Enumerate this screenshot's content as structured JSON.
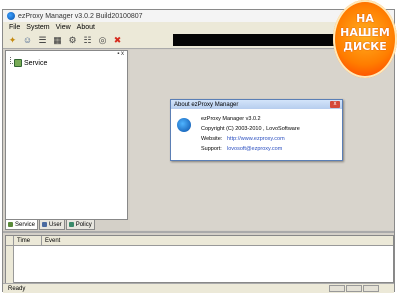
{
  "window": {
    "title": "ezProxy Manager v3.0.2 Build20100807"
  },
  "menu": [
    "File",
    "System",
    "View",
    "About"
  ],
  "toolbar": {
    "icons": [
      "wizard-icon",
      "users-icon",
      "list-icon",
      "grid-icon",
      "settings-icon",
      "network-icon",
      "search-icon",
      "stop-icon"
    ]
  },
  "left_pane": {
    "controls": "▪ x",
    "tree_item": "Service",
    "tabs": [
      {
        "label": "Service"
      },
      {
        "label": "User"
      },
      {
        "label": "Policy"
      }
    ]
  },
  "log": {
    "columns": [
      "Time",
      "Event"
    ]
  },
  "status": {
    "text": "Ready"
  },
  "dialog": {
    "title": "About ezProxy Manager",
    "close": "x",
    "product": "ezProxy Manager v3.0.2",
    "copyright": "Copyright (C) 2003-2010 , LovoSoftware",
    "website_label": "Website:",
    "website_value": "http://www.ezproxy.com",
    "support_label": "Support:",
    "support_value": "lovosoft@ezproxy.com"
  },
  "badge": {
    "line1": "НА",
    "line2": "НАШЕМ",
    "line3": "ДИСКЕ"
  }
}
